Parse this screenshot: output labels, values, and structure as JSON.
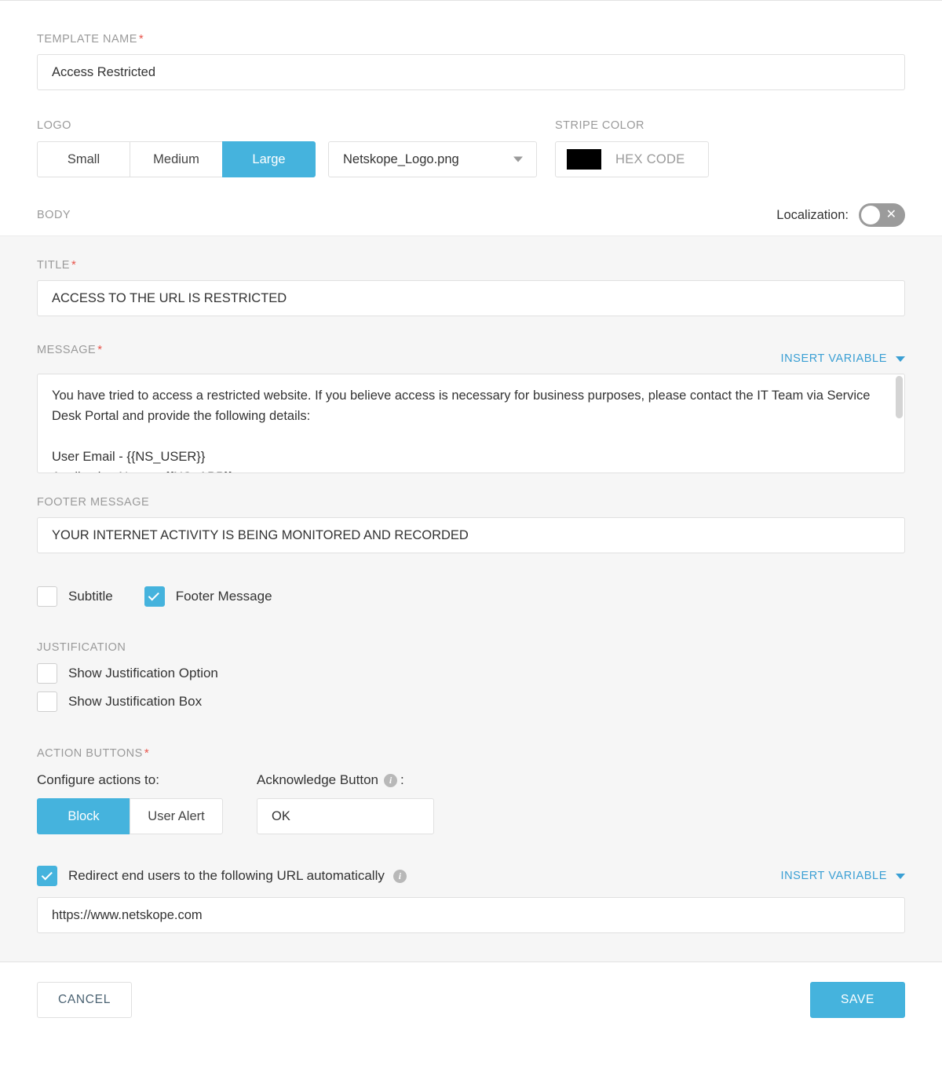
{
  "template_name": {
    "label": "TEMPLATE NAME",
    "required_mark": "*",
    "value": "Access Restricted"
  },
  "logo": {
    "label": "LOGO",
    "sizes": [
      {
        "label": "Small",
        "active": false
      },
      {
        "label": "Medium",
        "active": false
      },
      {
        "label": "Large",
        "active": true
      }
    ],
    "selected_file": "Netskope_Logo.png"
  },
  "stripe_color": {
    "label": "STRIPE COLOR",
    "swatch_hex": "#000000",
    "hex_code_label": "HEX CODE"
  },
  "body": {
    "label": "BODY",
    "localization_label": "Localization:",
    "localization_on": false
  },
  "title": {
    "label": "TITLE",
    "required_mark": "*",
    "value": "ACCESS TO THE URL IS RESTRICTED"
  },
  "message": {
    "label": "MESSAGE",
    "required_mark": "*",
    "insert_variable_label": "INSERT VARIABLE",
    "value": "You have tried to access a restricted website. If you believe access is necessary for business purposes, please contact the IT Team via Service Desk Portal and provide the following details:\n\nUser Email - {{NS_USER}}\nApplication Name - {{NS_APP}}"
  },
  "footer_message": {
    "label": "FOOTER MESSAGE",
    "value": "YOUR INTERNET ACTIVITY IS BEING MONITORED AND RECORDED"
  },
  "toggles": {
    "subtitle": {
      "label": "Subtitle",
      "checked": false
    },
    "footer_message": {
      "label": "Footer Message",
      "checked": true
    }
  },
  "justification": {
    "label": "JUSTIFICATION",
    "show_option": {
      "label": "Show Justification Option",
      "checked": false
    },
    "show_box": {
      "label": "Show Justification Box",
      "checked": false
    }
  },
  "action_buttons": {
    "label": "ACTION BUTTONS",
    "required_mark": "*",
    "configure_label": "Configure actions to:",
    "modes": [
      {
        "label": "Block",
        "active": true
      },
      {
        "label": "User Alert",
        "active": false
      }
    ],
    "acknowledge_label": "Acknowledge Button",
    "acknowledge_colon": ":",
    "acknowledge_value": "OK",
    "info_glyph": "i"
  },
  "redirect": {
    "label": "Redirect end users to the following URL automatically",
    "checked": true,
    "insert_variable_label": "INSERT VARIABLE",
    "url_value": "https://www.netskope.com",
    "info_glyph": "i"
  },
  "footer_actions": {
    "cancel_label": "CANCEL",
    "save_label": "SAVE"
  },
  "colors": {
    "accent": "#45b3dd",
    "link": "#3a9fd4",
    "required": "#e8534a",
    "body_bg": "#f6f6f6"
  }
}
